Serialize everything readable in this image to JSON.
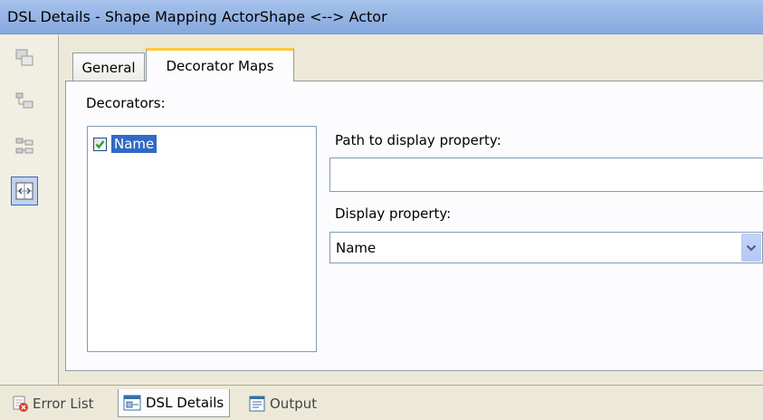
{
  "window": {
    "title": "DSL Details - Shape Mapping ActorShape <--> Actor"
  },
  "side_toolbar": {
    "buttons": [
      {
        "icon": "element-icon"
      },
      {
        "icon": "tree-icon"
      },
      {
        "icon": "hierarchy-icon"
      },
      {
        "icon": "mapping-icon",
        "selected": true
      }
    ]
  },
  "tabs": [
    {
      "label": "General",
      "active": false
    },
    {
      "label": "Decorator Maps",
      "active": true
    }
  ],
  "decorator_maps": {
    "decorators_label": "Decorators:",
    "decorators": [
      {
        "label": "Name",
        "checked": true,
        "selected": true
      }
    ],
    "path_label": "Path to display property:",
    "path_value": "",
    "display_label": "Display property:",
    "display_value": "Name"
  },
  "bottom_tabs": [
    {
      "label": "Error List",
      "icon": "error-list-icon",
      "active": false
    },
    {
      "label": "DSL Details",
      "icon": "dsl-details-icon",
      "active": true
    },
    {
      "label": "Output",
      "icon": "output-icon",
      "active": false
    }
  ],
  "colors": {
    "title_gradient": "#a6c2ec",
    "selection": "#316ac5",
    "active_tab_highlight": "#ffc83c",
    "panel_bg": "#fcfcfe",
    "window_bg": "#ece9d8"
  }
}
